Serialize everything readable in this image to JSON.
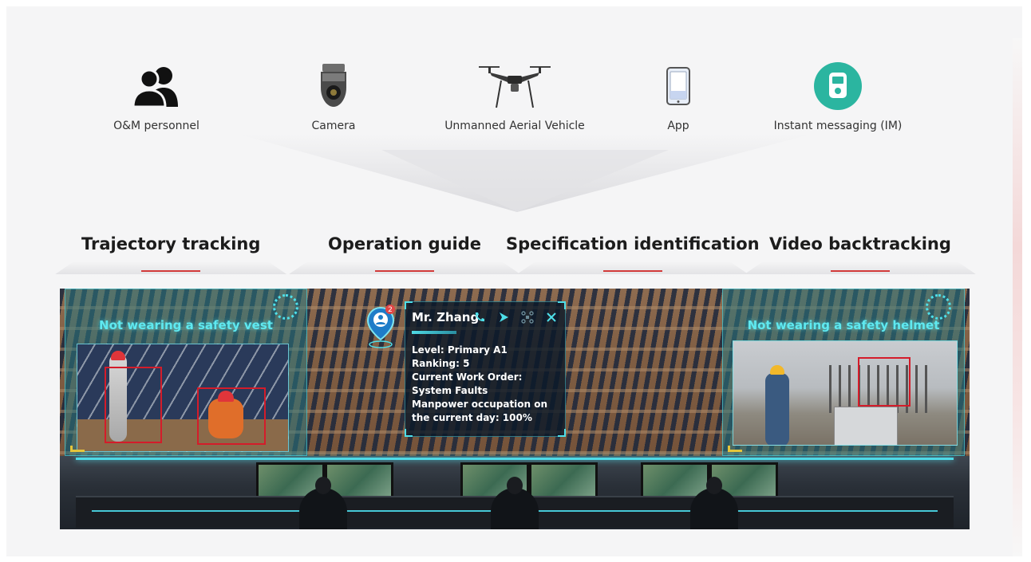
{
  "sources": [
    {
      "label": "O&M personnel",
      "icon": "people-group-icon"
    },
    {
      "label": "Camera",
      "icon": "dome-camera-icon"
    },
    {
      "label": "Unmanned Aerial Vehicle",
      "icon": "drone-icon"
    },
    {
      "label": "App",
      "icon": "mobile-phone-icon"
    },
    {
      "label": "Instant messaging (IM)",
      "icon": "chat-app-icon"
    }
  ],
  "capabilities": [
    {
      "title": "Trajectory tracking"
    },
    {
      "title": "Operation guide"
    },
    {
      "title": "Specification identification"
    },
    {
      "title": "Video backtracking"
    }
  ],
  "scene": {
    "alert_left": {
      "title": "Not wearing a safety vest"
    },
    "alert_right": {
      "title": "Not wearing a safety helmet"
    },
    "profile": {
      "badge_count": "2",
      "name": "Mr. Zhang",
      "lines": [
        "Level: Primary A1",
        "Ranking: 5",
        "Current Work Order:",
        "System Faults",
        "Manpower occupation on",
        "the current day: 100%"
      ]
    }
  },
  "colors": {
    "accent_red": "#d23a3a",
    "cyan": "#4ee0ea",
    "im_green": "#2bb5a0"
  }
}
